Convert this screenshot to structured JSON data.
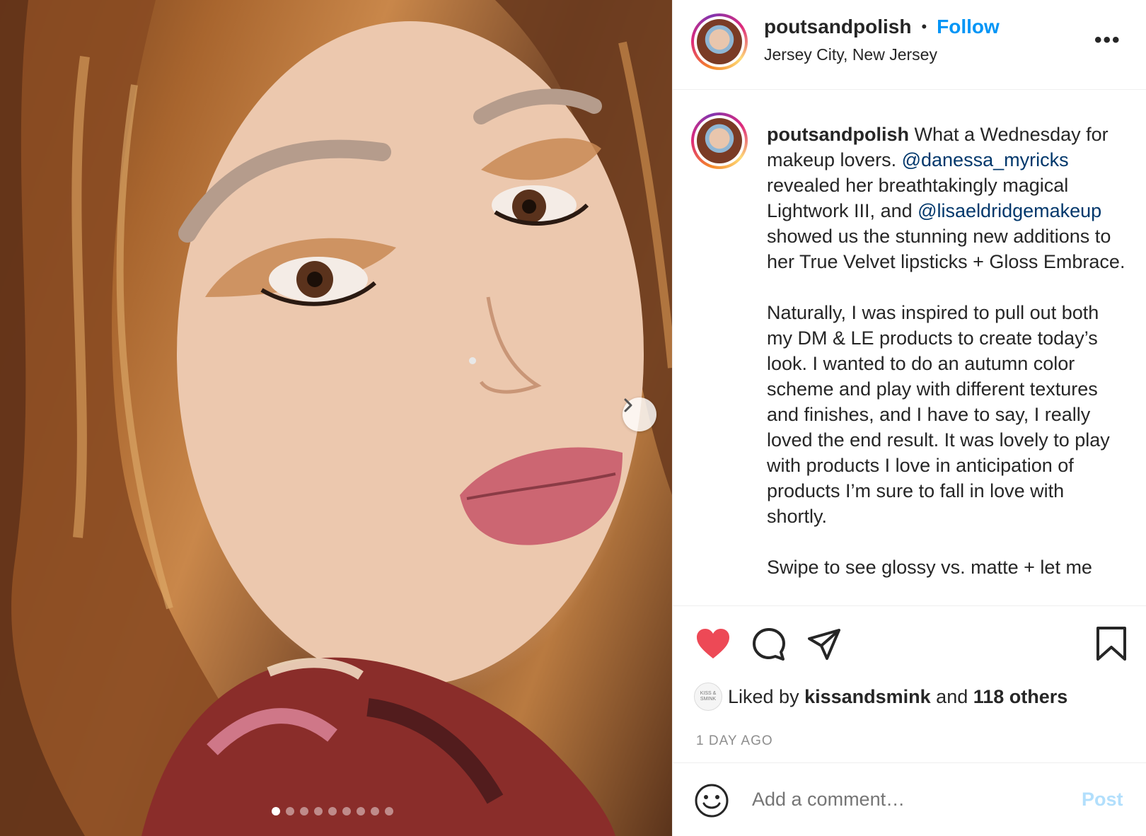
{
  "post": {
    "username": "poutsandpolish",
    "separator": "•",
    "follow_label": "Follow",
    "location": "Jersey City, New Jersey",
    "more_label": "•••"
  },
  "caption": {
    "username": "poutsandpolish",
    "p1_a": " What a Wednesday for makeup lovers. ",
    "mention1": "@danessa_myricks",
    "p1_b": " revealed her breathtakingly magical Lightwork III, and ",
    "mention2": "@lisaeldridgemakeup",
    "p1_c": " showed us the stunning new additions to her True Velvet lipsticks + Gloss Embrace.",
    "p2": "Naturally, I was inspired to pull out both my DM & LE products to create today’s look. I wanted to do an autumn color scheme and play with different textures and finishes, and I have to say, I really loved the end result. It was lovely to play with products I love in anticipation of products I’m sure to fall in love with shortly.",
    "p3": "Swipe to see glossy vs. matte + let me"
  },
  "likes": {
    "avatar_text": "KISS & SMINK",
    "prefix": "Liked by ",
    "user": "kissandsmink",
    "middle": " and ",
    "others": "118 others"
  },
  "timestamp": "1 DAY AGO",
  "comment": {
    "placeholder": "Add a comment…",
    "post_label": "Post"
  },
  "carousel": {
    "total_slides": 9,
    "active_index": 0
  },
  "icons": {
    "like": "heart-icon",
    "comment": "comment-icon",
    "share": "share-icon",
    "save": "bookmark-icon",
    "emoji": "smiley-icon",
    "next": "chevron-right-icon"
  },
  "colors": {
    "accent": "#0095f6",
    "like_red": "#ed4956",
    "mention": "#00376b",
    "muted": "#8e8e8e",
    "post_disabled": "#b2dffc"
  }
}
